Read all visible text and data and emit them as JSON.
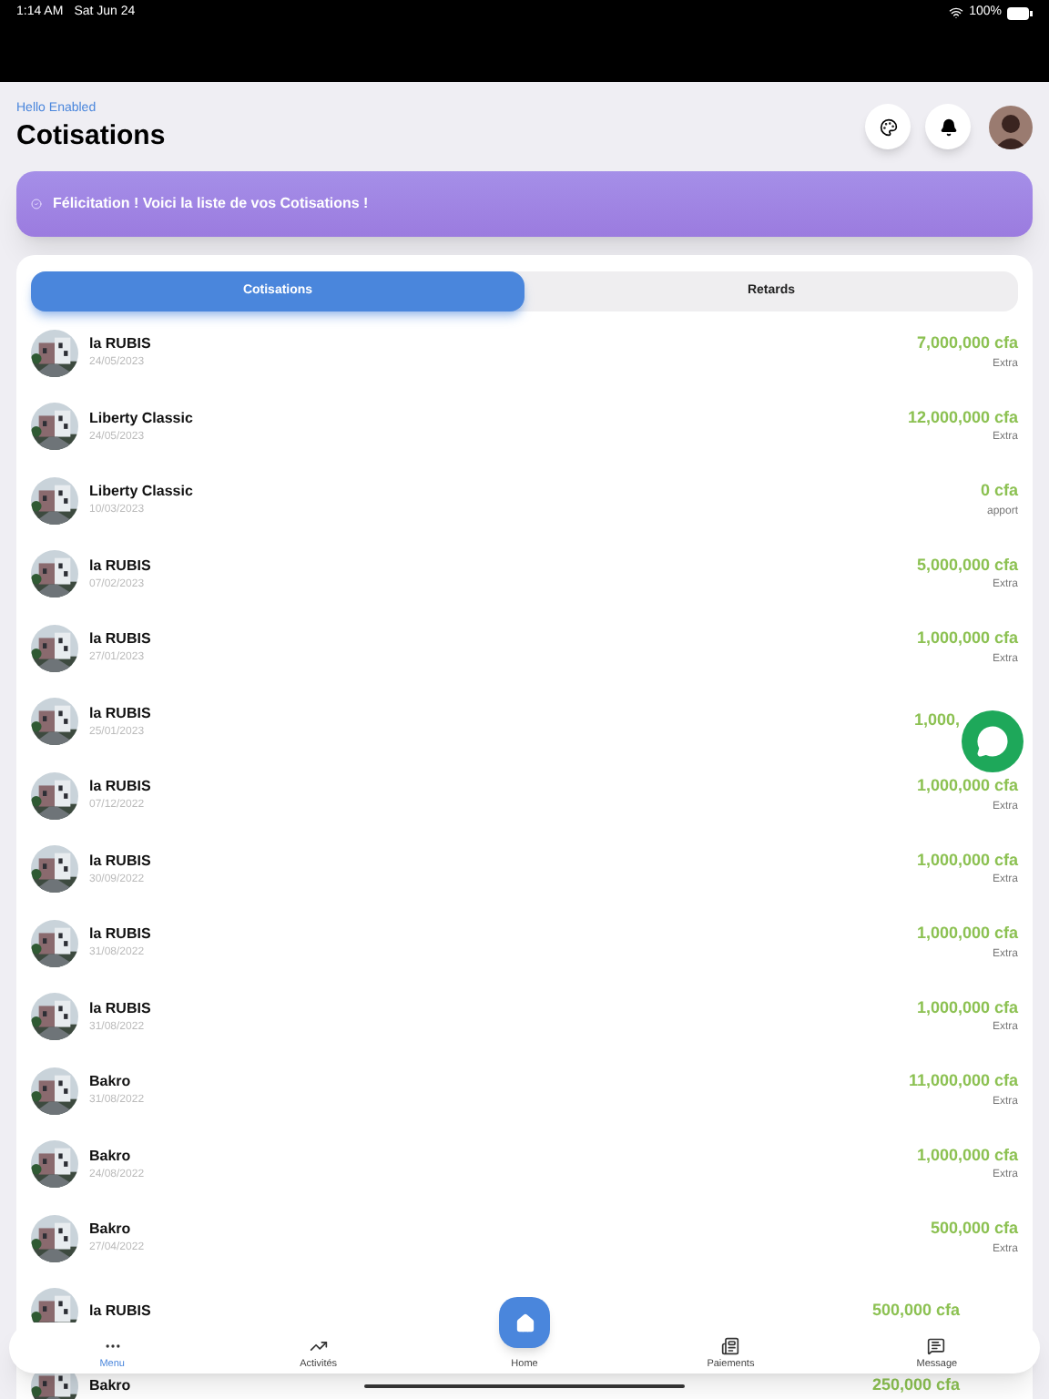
{
  "status_bar": {
    "time": "1:14 AM",
    "date": "Sat Jun 24",
    "battery": "100%"
  },
  "header": {
    "greeting": "Hello Enabled",
    "title": "Cotisations"
  },
  "banner": {
    "text": "Félicitation ! Voici la liste de vos Cotisations !"
  },
  "tabs": [
    {
      "label": "Cotisations",
      "selected": true
    },
    {
      "label": "Retards",
      "selected": false
    }
  ],
  "rows": [
    {
      "name": "la RUBIS",
      "date": "24/05/2023",
      "amount": "7,000,000 cfa",
      "type": "Extra"
    },
    {
      "name": "Liberty Classic",
      "date": "24/05/2023",
      "amount": "12,000,000 cfa",
      "type": "Extra"
    },
    {
      "name": "Liberty Classic",
      "date": "10/03/2023",
      "amount": "0 cfa",
      "type": "apport"
    },
    {
      "name": "la RUBIS",
      "date": "07/02/2023",
      "amount": "5,000,000 cfa",
      "type": "Extra"
    },
    {
      "name": "la RUBIS",
      "date": "27/01/2023",
      "amount": "1,000,000 cfa",
      "type": "Extra"
    },
    {
      "name": "la RUBIS",
      "date": "25/01/2023",
      "amount": "1,000,"
    },
    {
      "name": "la RUBIS",
      "date": "07/12/2022",
      "amount": "1,000,000 cfa",
      "type": "Extra"
    },
    {
      "name": "la RUBIS",
      "date": "30/09/2022",
      "amount": "1,000,000 cfa",
      "type": "Extra"
    },
    {
      "name": "la RUBIS",
      "date": "31/08/2022",
      "amount": "1,000,000 cfa",
      "type": "Extra"
    },
    {
      "name": "la RUBIS",
      "date": "31/08/2022",
      "amount": "1,000,000 cfa",
      "type": "Extra"
    },
    {
      "name": "Bakro",
      "date": "31/08/2022",
      "amount": "11,000,000 cfa",
      "type": "Extra"
    },
    {
      "name": "Bakro",
      "date": "24/08/2022",
      "amount": "1,000,000 cfa",
      "type": "Extra"
    },
    {
      "name": "Bakro",
      "date": "27/04/2022",
      "amount": "500,000 cfa",
      "type": "Extra"
    },
    {
      "name": "la RUBIS",
      "amount": "500,000 cfa"
    },
    {
      "name": "Bakro",
      "amount": "250,000 cfa"
    }
  ],
  "nav": [
    {
      "label": "Menu",
      "selected": true
    },
    {
      "label": "Activités",
      "selected": false
    },
    {
      "label": "Home",
      "selected": false
    },
    {
      "label": "Paiements",
      "selected": false
    },
    {
      "label": "Message",
      "selected": false
    }
  ]
}
